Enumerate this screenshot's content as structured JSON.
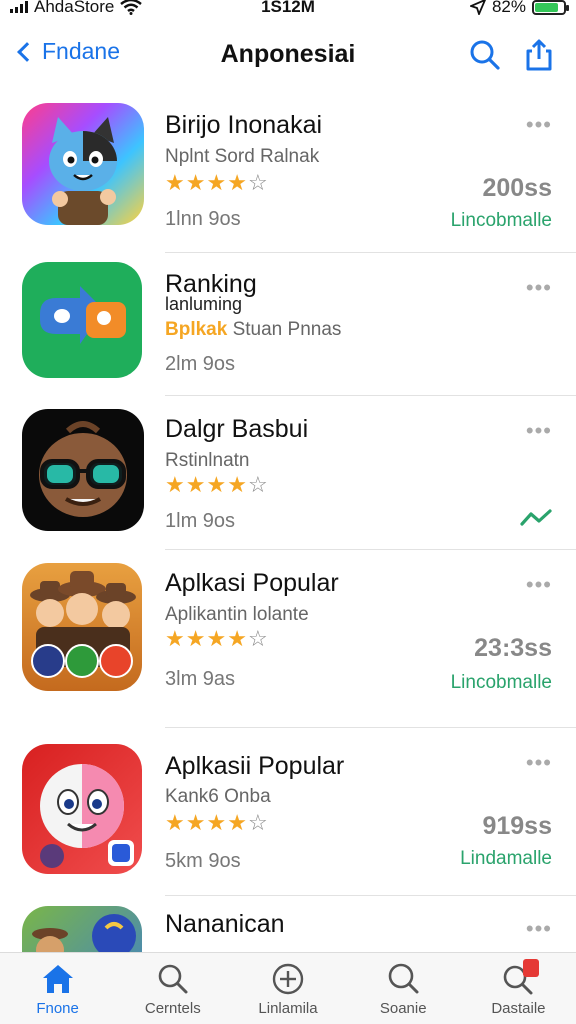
{
  "status_bar": {
    "carrier": "AhdaStore",
    "time": "1S12M",
    "battery": "82%",
    "battery_level": 0.82
  },
  "nav": {
    "back_label": "Fndane",
    "title": "Anponesiai"
  },
  "apps": [
    {
      "name": "Birijo Inonakai",
      "subtitle": "Nplnt Sord Ralnak",
      "subtitle_color": "#666666",
      "rating": 4,
      "size": "1lnn 9os",
      "count": "200ss",
      "action": "Lincobmalle",
      "icon": "cat-character-icon",
      "icon_bg": [
        "#ff3d8b",
        "#3dc4ff",
        "#ffd23d"
      ]
    },
    {
      "name": "Ranking",
      "name_echo": "lanluming",
      "subtitle_prefix": "Bplkak",
      "subtitle": "Stuan Pnnas",
      "rating": null,
      "size": "2lm 9os",
      "icon": "chat-bubbles-icon",
      "icon_bg": [
        "#1fae5b",
        "#19a854"
      ]
    },
    {
      "name": "Dalgr Basbui",
      "subtitle": "Rstinlnatn",
      "subtitle_color": "#666666",
      "rating": 4,
      "size": "1lm 9os",
      "trend_icon": "trend-icon",
      "icon": "sunglasses-character-icon",
      "icon_bg": [
        "#0a0a0a",
        "#1a1a1a"
      ]
    },
    {
      "name": "Aplkasi Popular",
      "subtitle": "Aplikantin lolante",
      "subtitle_color": "#666666",
      "rating": 4,
      "size": "3lm 9as",
      "count": "23:3ss",
      "action": "Lincobmalle",
      "icon": "cowboys-group-icon",
      "icon_bg": [
        "#e8a040",
        "#c46a1e"
      ]
    },
    {
      "name": "Aplkasii Popular",
      "subtitle": "Kank6 Onba",
      "subtitle_color": "#666666",
      "rating": 4,
      "size": "5km 9os",
      "count": "919ss",
      "action": "Lindamalle",
      "icon": "ball-character-icon",
      "icon_bg": [
        "#d82020",
        "#f04d4d"
      ]
    },
    {
      "name": "Nananican",
      "icon": "owl-character-icon",
      "icon_bg": [
        "#7ab648",
        "#3a7bd5"
      ]
    }
  ],
  "tabs": [
    {
      "label": "Fnone",
      "icon": "home-icon",
      "active": true
    },
    {
      "label": "Cerntels",
      "icon": "search-icon",
      "active": false
    },
    {
      "label": "Linlamila",
      "icon": "add-circle-icon",
      "active": false
    },
    {
      "label": "Soanie",
      "icon": "search-icon",
      "active": false
    },
    {
      "label": "Dastaile",
      "icon": "search-badge-icon",
      "active": false,
      "badge": true
    }
  ],
  "colors": {
    "accent": "#1a73e8",
    "star": "#f5a623",
    "action_green": "#2aa36c",
    "subtitle_orange": "#f5a623"
  }
}
